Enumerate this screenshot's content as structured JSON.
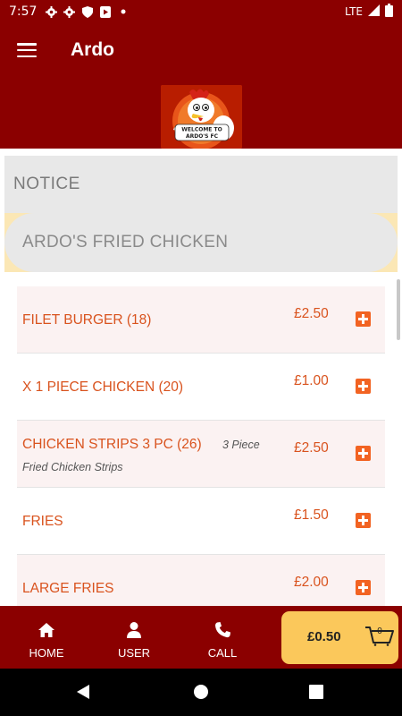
{
  "status_bar": {
    "time": "7:57",
    "network": "LTE",
    "icons": [
      "gear-icon",
      "gear-icon",
      "shield-icon",
      "play-protect-icon",
      "dot-icon",
      "signal-icon",
      "battery-icon"
    ]
  },
  "app_bar": {
    "title": "Ardo",
    "menu_icon": "hamburger-menu-icon"
  },
  "logo": {
    "text_line1": "WELCOME TO",
    "text_line2": "ARDO'S FC"
  },
  "notice": {
    "title": "NOTICE"
  },
  "banner": {
    "text": "ARDO'S FRIED CHICKEN"
  },
  "menu_items": [
    {
      "name": "FILET BURGER (18)",
      "price": "£2.50",
      "qty": "",
      "desc": ""
    },
    {
      "name": "X 1 PIECE CHICKEN (20)",
      "price": "£1.00",
      "qty": "",
      "desc": ""
    },
    {
      "name": "CHICKEN STRIPS 3 PC (26)",
      "price": "£2.50",
      "qty": "3 Piece",
      "desc": "Fried Chicken Strips"
    },
    {
      "name": "FRIES",
      "price": "£1.50",
      "qty": "",
      "desc": ""
    },
    {
      "name": "LARGE FRIES",
      "price": "£2.00",
      "qty": "",
      "desc": ""
    }
  ],
  "bottom_nav": {
    "home": "HOME",
    "user": "USER",
    "call": "CALL"
  },
  "cart": {
    "total": "£0.50",
    "count": "0"
  },
  "colors": {
    "primary": "#8b0000",
    "accent": "#f26322",
    "item_text": "#d9531e",
    "cart_bg": "#fbc85b"
  }
}
